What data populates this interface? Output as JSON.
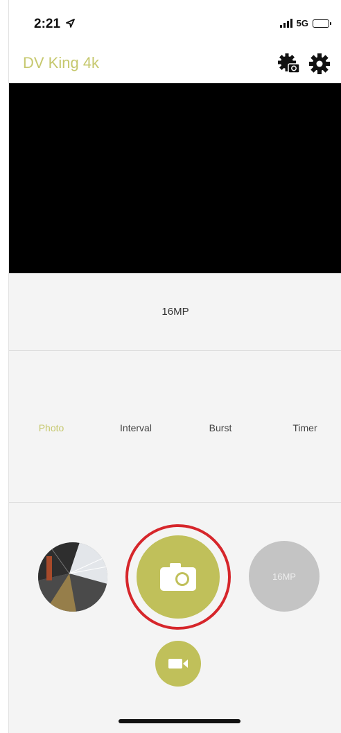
{
  "status_bar": {
    "time": "2:21",
    "network": "5G"
  },
  "header": {
    "title": "DV King 4k",
    "icons": [
      "camera-settings-icon",
      "gear-icon"
    ]
  },
  "preview": {
    "resolution": "16MP"
  },
  "modes": {
    "tabs": [
      {
        "label": "Photo",
        "active": true
      },
      {
        "label": "Interval",
        "active": false
      },
      {
        "label": "Burst",
        "active": false
      },
      {
        "label": "Timer",
        "active": false
      }
    ]
  },
  "controls": {
    "resolution_button": "16MP",
    "shutter_icon": "camera-icon",
    "video_icon": "video-camera-icon",
    "thumbnail": "last-captured-thumbnail"
  },
  "colors": {
    "accent": "#c0c05a",
    "title": "#c6c86e",
    "highlight_ring": "#d6262b"
  }
}
